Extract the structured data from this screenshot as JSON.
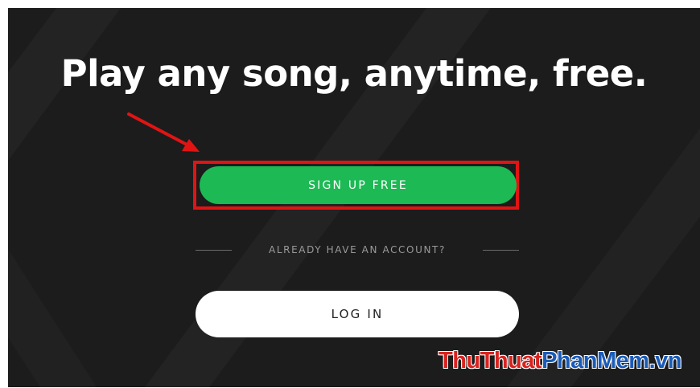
{
  "hero": {
    "headline": "Play any song, anytime, free."
  },
  "signup": {
    "label": "SIGN UP FREE"
  },
  "divider": {
    "text": "ALREADY HAVE AN ACCOUNT?"
  },
  "login": {
    "label": "LOG IN"
  },
  "watermark": {
    "part1": "ThuThuat",
    "part2": "PhanMem",
    "part3": ".vn"
  },
  "colors": {
    "background": "#1c1c1c",
    "signup_green": "#1db954",
    "highlight_red": "#e11414",
    "login_bg": "#ffffff"
  }
}
